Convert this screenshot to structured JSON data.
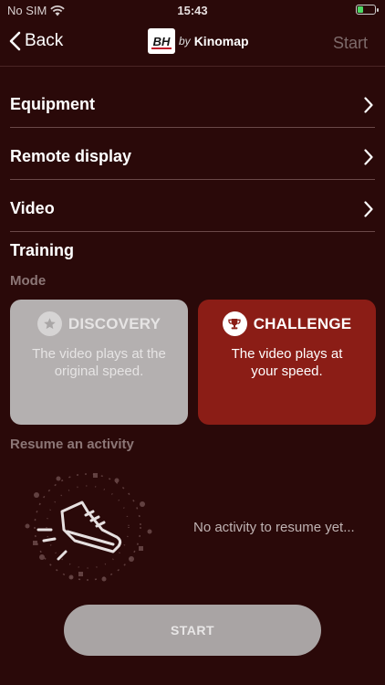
{
  "status_bar": {
    "carrier": "No SIM",
    "time": "15:43"
  },
  "nav": {
    "back_label": "Back",
    "logo_badge": "BH",
    "logo_by": "by",
    "logo_brand": "Kinomap",
    "start_label": "Start"
  },
  "menu": [
    {
      "label": "Equipment"
    },
    {
      "label": "Remote display"
    },
    {
      "label": "Video"
    }
  ],
  "training": {
    "title": "Training",
    "mode_label": "Mode",
    "modes": [
      {
        "title": "DISCOVERY",
        "description": "The video plays at the original speed.",
        "selected": false
      },
      {
        "title": "CHALLENGE",
        "description": "The video plays at your speed.",
        "selected": true
      }
    ]
  },
  "resume": {
    "title": "Resume an activity",
    "empty_text": "No activity to resume yet..."
  },
  "start_button": {
    "label": "START"
  },
  "colors": {
    "background": "#2a0909",
    "accent": "#8b1d16",
    "disabled": "#a9a4a4"
  }
}
